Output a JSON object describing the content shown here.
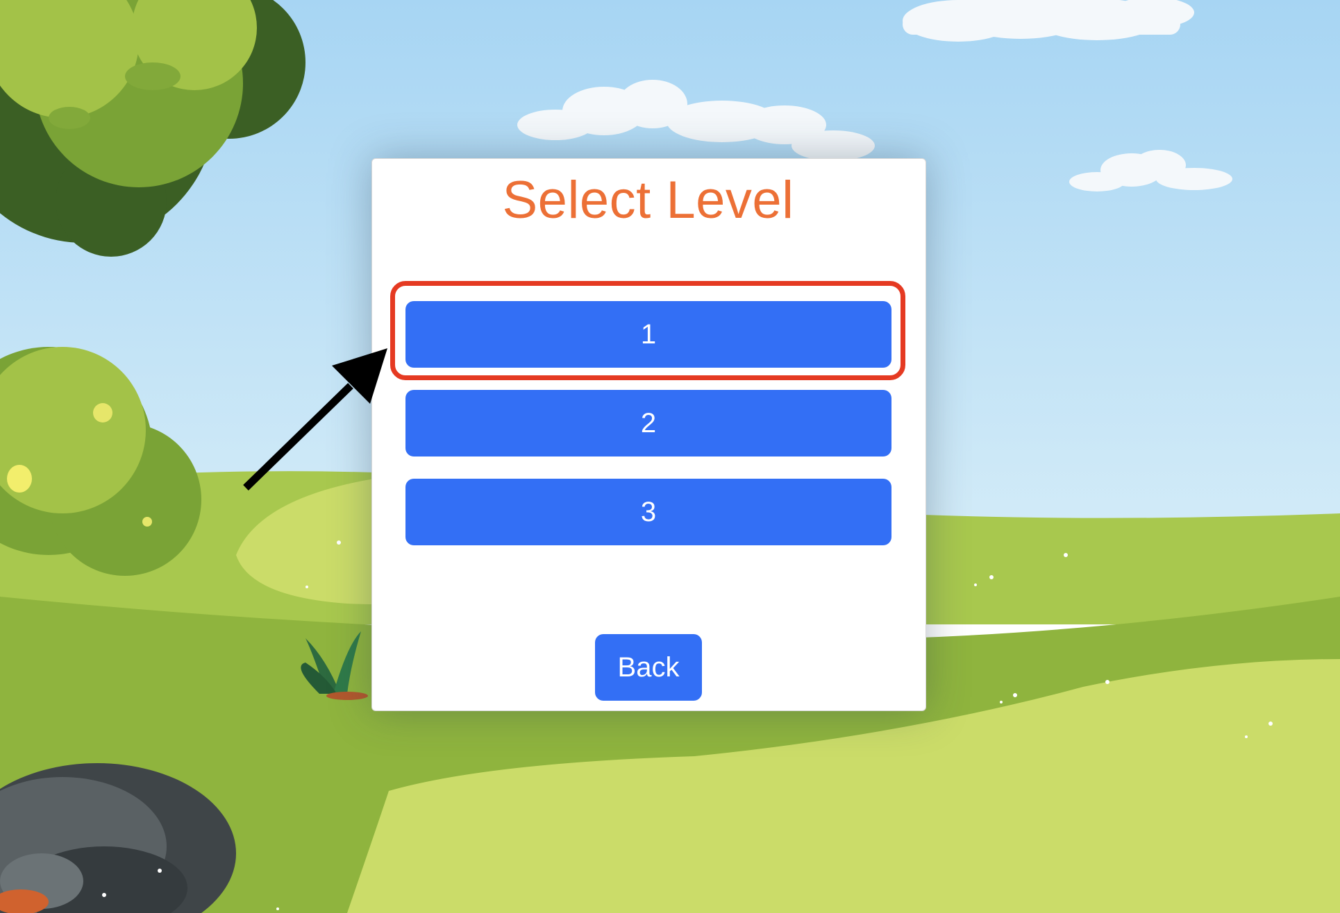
{
  "dialog": {
    "title": "Select Level",
    "levels": [
      {
        "label": "1",
        "highlighted": true
      },
      {
        "label": "2",
        "highlighted": false
      },
      {
        "label": "3",
        "highlighted": false
      }
    ],
    "back_label": "Back"
  },
  "colors": {
    "title": "#ec7036",
    "button": "#336ff5",
    "button_text": "#ffffff",
    "highlight": "#e53a22",
    "arrow": "#000000",
    "sky": "#aed8f2",
    "grass_light": "#c8db66",
    "grass_dark": "#86ad3a"
  },
  "annotations": {
    "arrow_icon": "arrow-pointing-at-level-1",
    "highlight_box": "red-rounded-rectangle"
  }
}
